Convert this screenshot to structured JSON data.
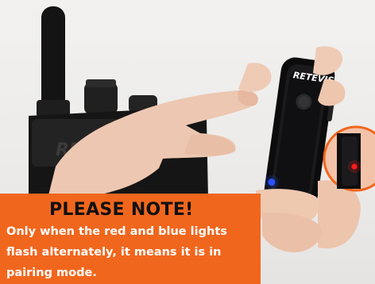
{
  "device": {
    "brand_mark": "RETEVIS",
    "radio_brand_fragment": "RE"
  },
  "notice": {
    "title": "PLEASE NOTE!",
    "lines": [
      "Only when the red and blue lights",
      "flash alternately, it means it is in",
      "pairing mode."
    ]
  },
  "colors": {
    "banner": "#f1661d",
    "title_text": "#101010",
    "body_text": "#ffffff",
    "blue_led": "#2a52ff",
    "red_led": "#ff1a1a",
    "inset_ring": "#f1661d"
  }
}
